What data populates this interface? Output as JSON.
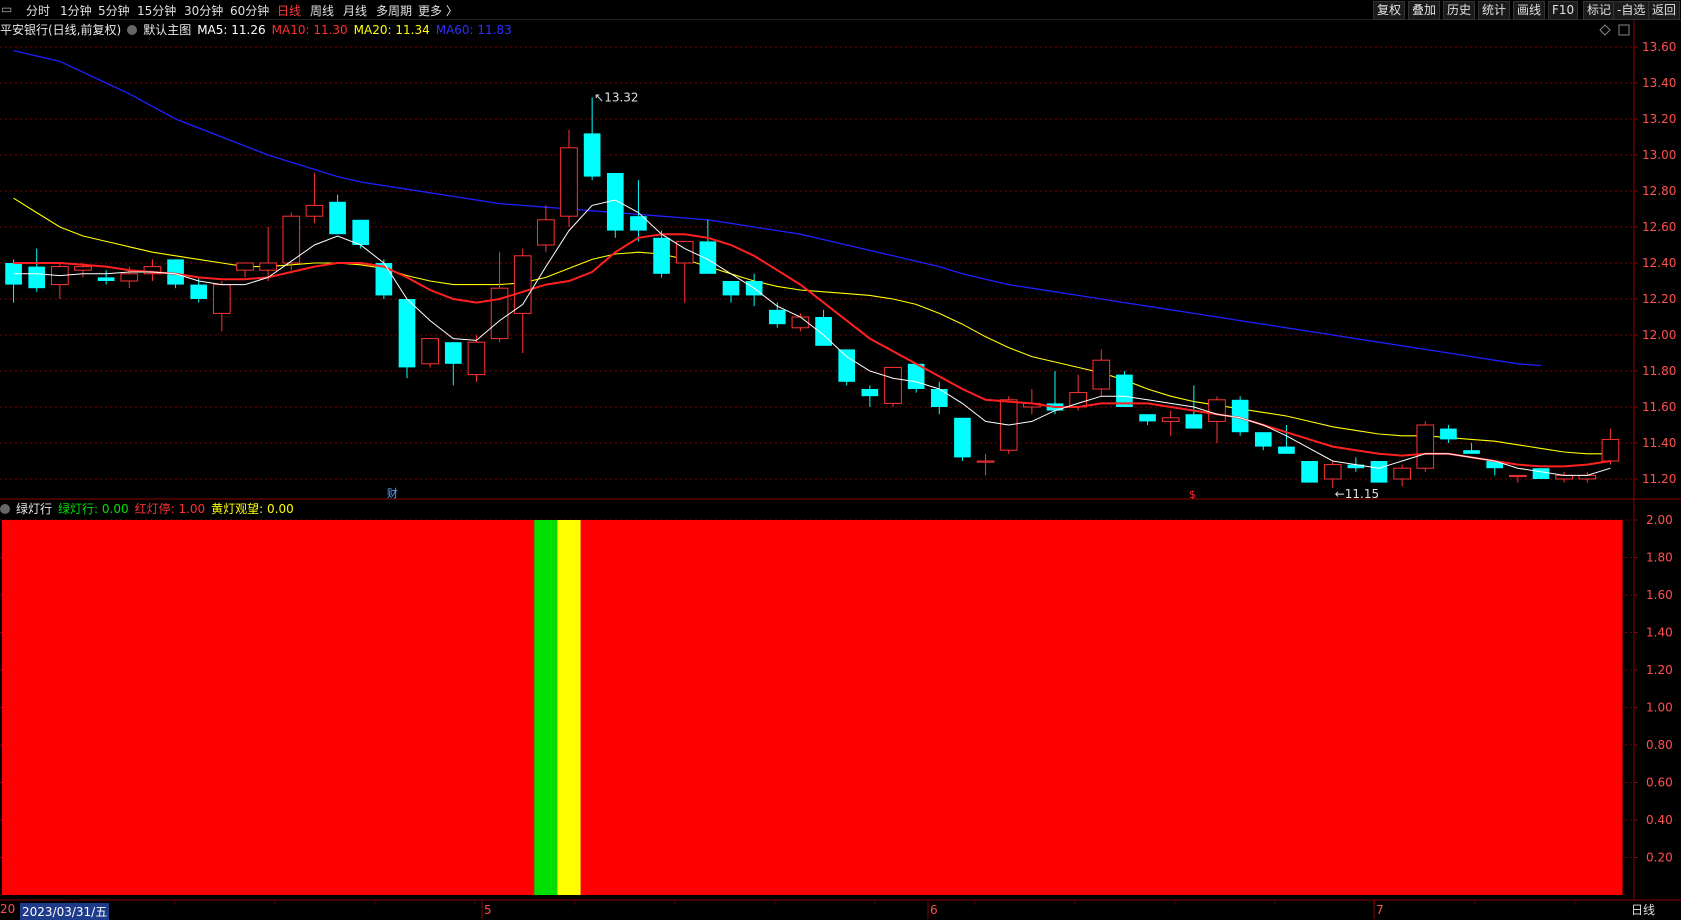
{
  "toolbar": {
    "periods": [
      "分时",
      "1分钟",
      "5分钟",
      "15分钟",
      "30分钟",
      "60分钟",
      "日线",
      "周线",
      "月线",
      "多周期",
      "更多 〉"
    ],
    "active_period": "日线",
    "right_buttons": [
      "复权",
      "叠加",
      "历史",
      "统计",
      "画线",
      "F10",
      "标记",
      "-自选",
      "返回"
    ]
  },
  "main_legend": {
    "title": "平安银行(日线,前复权)",
    "template": "默认主图",
    "ma5": "MA5: 11.26",
    "ma10": "MA10: 11.30",
    "ma20": "MA20: 11.34",
    "ma60": "MA60: 11.83"
  },
  "indicator_legend": {
    "title": "绿灯行",
    "green": "绿灯行: 0.00",
    "red": "红灯停: 1.00",
    "yellow": "黄灯观望: 0.00"
  },
  "annotations": {
    "high_label": "13.32",
    "low_label": "←11.15",
    "fin_marker": "财",
    "dividend_marker": "$"
  },
  "footer": {
    "corner": "20",
    "date": "2023/03/31/五",
    "months": [
      "5",
      "6",
      "7"
    ],
    "period": "日线"
  },
  "colors": {
    "up": "#ff3333",
    "down": "#00ffff",
    "ma5": "#ffffff",
    "ma10": "#ff2020",
    "ma20": "#ffff00",
    "ma60": "#2020ff",
    "light_red": "#ff0000",
    "light_green": "#00e000",
    "light_yellow": "#ffff00",
    "axis_text": "#ff5050",
    "grid": "#7a0000"
  },
  "chart_data": [
    {
      "type": "candlestick",
      "title": "平安银行(日线,前复权)",
      "ylim": [
        11.1,
        13.65
      ],
      "y_ticks": [
        11.2,
        11.4,
        11.6,
        11.8,
        12.0,
        12.2,
        12.4,
        12.6,
        12.8,
        13.0,
        13.2,
        13.4,
        13.6
      ],
      "candles": [
        {
          "o": 12.4,
          "h": 12.42,
          "l": 12.18,
          "c": 12.28
        },
        {
          "o": 12.38,
          "h": 12.48,
          "l": 12.24,
          "c": 12.26
        },
        {
          "o": 12.28,
          "h": 12.4,
          "l": 12.2,
          "c": 12.38
        },
        {
          "o": 12.36,
          "h": 12.4,
          "l": 12.32,
          "c": 12.38
        },
        {
          "o": 12.32,
          "h": 12.36,
          "l": 12.28,
          "c": 12.3
        },
        {
          "o": 12.3,
          "h": 12.38,
          "l": 12.26,
          "c": 12.34
        },
        {
          "o": 12.34,
          "h": 12.42,
          "l": 12.3,
          "c": 12.38
        },
        {
          "o": 12.42,
          "h": 12.42,
          "l": 12.26,
          "c": 12.28
        },
        {
          "o": 12.28,
          "h": 12.32,
          "l": 12.18,
          "c": 12.2
        },
        {
          "o": 12.12,
          "h": 12.3,
          "l": 12.02,
          "c": 12.28
        },
        {
          "o": 12.36,
          "h": 12.4,
          "l": 12.32,
          "c": 12.4
        },
        {
          "o": 12.36,
          "h": 12.6,
          "l": 12.3,
          "c": 12.4
        },
        {
          "o": 12.4,
          "h": 12.68,
          "l": 12.36,
          "c": 12.66
        },
        {
          "o": 12.66,
          "h": 12.9,
          "l": 12.62,
          "c": 12.72
        },
        {
          "o": 12.74,
          "h": 12.78,
          "l": 12.56,
          "c": 12.56
        },
        {
          "o": 12.64,
          "h": 12.64,
          "l": 12.48,
          "c": 12.5
        },
        {
          "o": 12.4,
          "h": 12.42,
          "l": 12.2,
          "c": 12.22
        },
        {
          "o": 12.2,
          "h": 12.2,
          "l": 11.76,
          "c": 11.82
        },
        {
          "o": 11.84,
          "h": 11.98,
          "l": 11.82,
          "c": 11.98
        },
        {
          "o": 11.96,
          "h": 11.96,
          "l": 11.72,
          "c": 11.84
        },
        {
          "o": 11.78,
          "h": 12.0,
          "l": 11.74,
          "c": 11.96
        },
        {
          "o": 11.98,
          "h": 12.46,
          "l": 11.96,
          "c": 12.26
        },
        {
          "o": 12.12,
          "h": 12.48,
          "l": 11.9,
          "c": 12.44
        },
        {
          "o": 12.5,
          "h": 12.72,
          "l": 12.46,
          "c": 12.64
        },
        {
          "o": 12.66,
          "h": 13.14,
          "l": 12.6,
          "c": 13.04
        },
        {
          "o": 13.12,
          "h": 13.32,
          "l": 12.86,
          "c": 12.88
        },
        {
          "o": 12.9,
          "h": 12.9,
          "l": 12.54,
          "c": 12.58
        },
        {
          "o": 12.66,
          "h": 12.86,
          "l": 12.52,
          "c": 12.58
        },
        {
          "o": 12.54,
          "h": 12.58,
          "l": 12.32,
          "c": 12.34
        },
        {
          "o": 12.4,
          "h": 12.52,
          "l": 12.18,
          "c": 12.52
        },
        {
          "o": 12.52,
          "h": 12.64,
          "l": 12.34,
          "c": 12.34
        },
        {
          "o": 12.3,
          "h": 12.3,
          "l": 12.18,
          "c": 12.22
        },
        {
          "o": 12.3,
          "h": 12.34,
          "l": 12.16,
          "c": 12.22
        },
        {
          "o": 12.14,
          "h": 12.18,
          "l": 12.04,
          "c": 12.06
        },
        {
          "o": 12.04,
          "h": 12.12,
          "l": 12.02,
          "c": 12.1
        },
        {
          "o": 12.1,
          "h": 12.14,
          "l": 11.94,
          "c": 11.94
        },
        {
          "o": 11.92,
          "h": 11.92,
          "l": 11.72,
          "c": 11.74
        },
        {
          "o": 11.7,
          "h": 11.72,
          "l": 11.6,
          "c": 11.66
        },
        {
          "o": 11.62,
          "h": 11.82,
          "l": 11.6,
          "c": 11.82
        },
        {
          "o": 11.84,
          "h": 11.84,
          "l": 11.68,
          "c": 11.7
        },
        {
          "o": 11.7,
          "h": 11.74,
          "l": 11.56,
          "c": 11.6
        },
        {
          "o": 11.54,
          "h": 11.54,
          "l": 11.3,
          "c": 11.32
        },
        {
          "o": 11.3,
          "h": 11.34,
          "l": 11.22,
          "c": 11.3
        },
        {
          "o": 11.36,
          "h": 11.66,
          "l": 11.34,
          "c": 11.64
        },
        {
          "o": 11.6,
          "h": 11.7,
          "l": 11.56,
          "c": 11.62
        },
        {
          "o": 11.62,
          "h": 11.8,
          "l": 11.56,
          "c": 11.58
        },
        {
          "o": 11.6,
          "h": 11.78,
          "l": 11.58,
          "c": 11.68
        },
        {
          "o": 11.7,
          "h": 11.92,
          "l": 11.66,
          "c": 11.86
        },
        {
          "o": 11.78,
          "h": 11.8,
          "l": 11.6,
          "c": 11.6
        },
        {
          "o": 11.56,
          "h": 11.56,
          "l": 11.5,
          "c": 11.52
        },
        {
          "o": 11.52,
          "h": 11.58,
          "l": 11.44,
          "c": 11.54
        },
        {
          "o": 11.56,
          "h": 11.72,
          "l": 11.48,
          "c": 11.48
        },
        {
          "o": 11.52,
          "h": 11.66,
          "l": 11.4,
          "c": 11.64
        },
        {
          "o": 11.64,
          "h": 11.66,
          "l": 11.44,
          "c": 11.46
        },
        {
          "o": 11.46,
          "h": 11.46,
          "l": 11.36,
          "c": 11.38
        },
        {
          "o": 11.38,
          "h": 11.5,
          "l": 11.34,
          "c": 11.34
        },
        {
          "o": 11.3,
          "h": 11.3,
          "l": 11.18,
          "c": 11.18
        },
        {
          "o": 11.2,
          "h": 11.3,
          "l": 11.15,
          "c": 11.28
        },
        {
          "o": 11.28,
          "h": 11.32,
          "l": 11.24,
          "c": 11.26
        },
        {
          "o": 11.3,
          "h": 11.3,
          "l": 11.18,
          "c": 11.18
        },
        {
          "o": 11.2,
          "h": 11.28,
          "l": 11.16,
          "c": 11.26
        },
        {
          "o": 11.26,
          "h": 11.52,
          "l": 11.24,
          "c": 11.5
        },
        {
          "o": 11.48,
          "h": 11.5,
          "l": 11.4,
          "c": 11.42
        },
        {
          "o": 11.36,
          "h": 11.4,
          "l": 11.34,
          "c": 11.34
        },
        {
          "o": 11.3,
          "h": 11.3,
          "l": 11.22,
          "c": 11.26
        },
        {
          "o": 11.22,
          "h": 11.22,
          "l": 11.18,
          "c": 11.22
        },
        {
          "o": 11.26,
          "h": 11.26,
          "l": 11.2,
          "c": 11.2
        },
        {
          "o": 11.2,
          "h": 11.24,
          "l": 11.18,
          "c": 11.22
        },
        {
          "o": 11.2,
          "h": 11.24,
          "l": 11.18,
          "c": 11.22
        },
        {
          "o": 11.3,
          "h": 11.48,
          "l": 11.28,
          "c": 11.42
        }
      ],
      "ma60": [
        13.58,
        13.55,
        13.52,
        13.46,
        13.4,
        13.34,
        13.27,
        13.2,
        13.15,
        13.1,
        13.05,
        13.0,
        12.96,
        12.92,
        12.88,
        12.85,
        12.83,
        12.81,
        12.79,
        12.77,
        12.75,
        12.73,
        12.72,
        12.71,
        12.7,
        12.69,
        12.68,
        12.67,
        12.66,
        12.65,
        12.64,
        12.62,
        12.6,
        12.58,
        12.56,
        12.53,
        12.5,
        12.47,
        12.44,
        12.41,
        12.38,
        12.34,
        12.31,
        12.28,
        12.26,
        12.24,
        12.22,
        12.2,
        12.18,
        12.16,
        12.14,
        12.12,
        12.1,
        12.08,
        12.06,
        12.04,
        12.02,
        12.0,
        11.98,
        11.96,
        11.94,
        11.92,
        11.9,
        11.88,
        11.86,
        11.84,
        11.83
      ],
      "ma20": [
        12.76,
        12.68,
        12.6,
        12.55,
        12.52,
        12.49,
        12.46,
        12.44,
        12.42,
        12.4,
        12.38,
        12.38,
        12.39,
        12.4,
        12.4,
        12.39,
        12.37,
        12.33,
        12.3,
        12.28,
        12.28,
        12.28,
        12.29,
        12.32,
        12.37,
        12.42,
        12.45,
        12.46,
        12.45,
        12.42,
        12.38,
        12.34,
        12.3,
        12.27,
        12.25,
        12.24,
        12.23,
        12.22,
        12.2,
        12.17,
        12.12,
        12.06,
        11.99,
        11.93,
        11.88,
        11.85,
        11.82,
        11.79,
        11.75,
        11.7,
        11.66,
        11.63,
        11.61,
        11.59,
        11.57,
        11.55,
        11.52,
        11.49,
        11.47,
        11.45,
        11.44,
        11.44,
        11.43,
        11.42,
        11.41,
        11.39,
        11.37,
        11.35,
        11.34,
        11.34
      ],
      "ma10": [
        12.4,
        12.4,
        12.4,
        12.39,
        12.38,
        12.36,
        12.35,
        12.34,
        12.32,
        12.31,
        12.31,
        12.32,
        12.35,
        12.38,
        12.4,
        12.4,
        12.38,
        12.32,
        12.25,
        12.2,
        12.18,
        12.2,
        12.24,
        12.28,
        12.3,
        12.35,
        12.46,
        12.54,
        12.56,
        12.56,
        12.54,
        12.5,
        12.44,
        12.36,
        12.28,
        12.18,
        12.08,
        11.98,
        11.91,
        11.84,
        11.77,
        11.7,
        11.64,
        11.63,
        11.62,
        11.6,
        11.6,
        11.62,
        11.62,
        11.62,
        11.6,
        11.58,
        11.56,
        11.54,
        11.5,
        11.46,
        11.42,
        11.38,
        11.36,
        11.34,
        11.33,
        11.34,
        11.34,
        11.32,
        11.3,
        11.28,
        11.27,
        11.27,
        11.28,
        11.3
      ],
      "ma5": [
        12.34,
        12.34,
        12.33,
        12.34,
        12.34,
        12.35,
        12.35,
        12.34,
        12.3,
        12.28,
        12.28,
        12.32,
        12.41,
        12.5,
        12.55,
        12.5,
        12.4,
        12.2,
        12.08,
        11.98,
        11.97,
        12.08,
        12.17,
        12.38,
        12.58,
        12.72,
        12.75,
        12.68,
        12.56,
        12.48,
        12.42,
        12.34,
        12.26,
        12.16,
        12.1,
        12.0,
        11.88,
        11.8,
        11.76,
        11.74,
        11.7,
        11.62,
        11.52,
        11.5,
        11.52,
        11.58,
        11.62,
        11.66,
        11.66,
        11.64,
        11.62,
        11.6,
        11.56,
        11.54,
        11.5,
        11.44,
        11.37,
        11.3,
        11.28,
        11.26,
        11.3,
        11.34,
        11.34,
        11.32,
        11.3,
        11.26,
        11.24,
        11.22,
        11.22,
        11.26
      ]
    },
    {
      "type": "bar",
      "title": "绿灯行",
      "ylim": [
        0,
        2.0
      ],
      "y_ticks": [
        0.2,
        0.4,
        0.6,
        0.8,
        1.0,
        1.2,
        1.4,
        1.6,
        1.8,
        2.0
      ],
      "signal_per_bar": [
        "red",
        "red",
        "red",
        "red",
        "red",
        "red",
        "red",
        "red",
        "red",
        "red",
        "red",
        "red",
        "red",
        "red",
        "red",
        "red",
        "red",
        "red",
        "red",
        "red",
        "red",
        "red",
        "red",
        "green",
        "yellow",
        "red",
        "red",
        "red",
        "red",
        "red",
        "red",
        "red",
        "red",
        "red",
        "red",
        "red",
        "red",
        "red",
        "red",
        "red",
        "red",
        "red",
        "red",
        "red",
        "red",
        "red",
        "red",
        "red",
        "red",
        "red",
        "red",
        "red",
        "red",
        "red",
        "red",
        "red",
        "red",
        "red",
        "red",
        "red",
        "red",
        "red",
        "red",
        "red",
        "red",
        "red",
        "red",
        "red",
        "red",
        "red"
      ],
      "value": 2.0
    }
  ]
}
